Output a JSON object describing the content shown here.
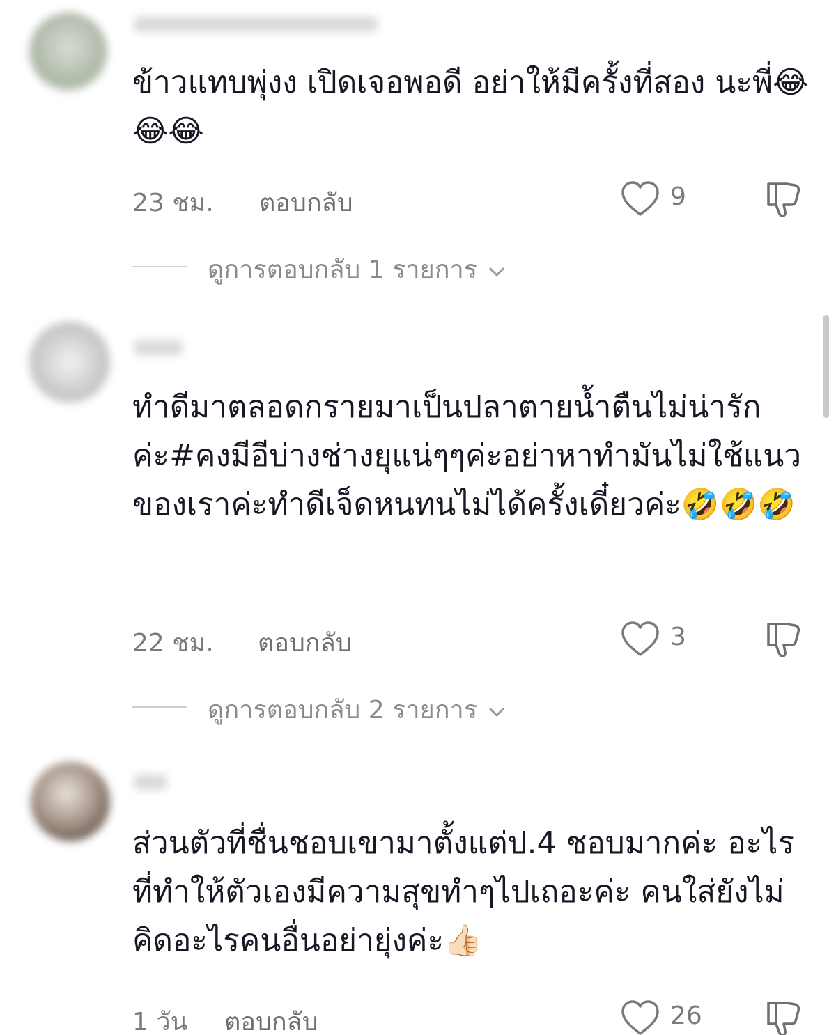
{
  "comments": [
    {
      "text": "ข้าวแทบพุ่งง เปิดเจอพอดี อย่าให้มีครั้งที่สอง นะพี่😂😂😂",
      "time": "23 ชม.",
      "reply_label": "ตอบกลับ",
      "likes": "9",
      "view_replies": "ดูการตอบกลับ 1 รายการ"
    },
    {
      "text": "ทำดีมาตลอดกรายมาเป็นปลาตายน้ำตืนไม่น่ารักค่ะ#คงมีอีบ่างช่างยุแน่ๆๆค่ะอย่าหาทำมันไม่ใช้แนวของเราค่ะทำดีเจ็ดหนทนไม่ได้ครั้งเดี๋ยวค่ะ🤣🤣🤣",
      "time": "22 ชม.",
      "reply_label": "ตอบกลับ",
      "likes": "3",
      "view_replies": "ดูการตอบกลับ 2 รายการ"
    },
    {
      "text": "ส่วนตัวที่ชื่นชอบเขามาตั้งแต่ป.4 ชอบมากค่ะ อะไรที่ทำให้ตัวเองมีความสุขทำๆไปเถอะค่ะ คนใส่ยังไม่คิดอะไรคนอื่นอย่ายุ่งค่ะ👍🏻",
      "time": "1 วัน",
      "reply_label": "ตอบกลับ",
      "likes": "26"
    }
  ],
  "icons": {
    "like": "heart-outline-icon",
    "dislike": "thumbs-down-outline-icon",
    "expand": "chevron-down-icon"
  },
  "colors": {
    "text": "#161823",
    "meta": "#7a7a7a",
    "divider": "#d0d0d0"
  }
}
